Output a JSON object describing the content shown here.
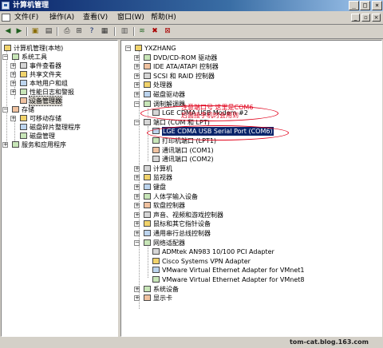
{
  "window": {
    "title": "计算机管理"
  },
  "menu": [
    "文件(F)",
    "操作(A)",
    "查看(V)",
    "窗口(W)",
    "帮助(H)"
  ],
  "toolbar": [
    "back-icon",
    "forward-icon",
    "up-icon",
    "properties-icon",
    "refresh-icon",
    "print-icon",
    "help-icon",
    "console-icon",
    "scan-icon",
    "disable-icon",
    "uninstall-icon"
  ],
  "left_tree": [
    {
      "label": "计算机管理(本地)",
      "depth": 0,
      "expander": "minus"
    },
    {
      "label": "系统工具",
      "depth": 1,
      "expander": "minus"
    },
    {
      "label": "事件查看器",
      "depth": 2,
      "expander": "plus"
    },
    {
      "label": "共享文件夹",
      "depth": 2,
      "expander": "plus"
    },
    {
      "label": "本地用户和组",
      "depth": 2,
      "expander": "plus"
    },
    {
      "label": "性能日志和警报",
      "depth": 2,
      "expander": "plus"
    },
    {
      "label": "设备管理器",
      "depth": 2,
      "expander": "none",
      "selected": true
    },
    {
      "label": "存储",
      "depth": 1,
      "expander": "minus"
    },
    {
      "label": "可移动存储",
      "depth": 2,
      "expander": "plus"
    },
    {
      "label": "磁盘碎片整理程序",
      "depth": 2,
      "expander": "none"
    },
    {
      "label": "磁盘管理",
      "depth": 2,
      "expander": "none"
    },
    {
      "label": "服务和应用程序",
      "depth": 1,
      "expander": "plus"
    }
  ],
  "device_tree": [
    {
      "label": "YXZHANG",
      "depth": 0,
      "expander": "minus"
    },
    {
      "label": "DVD/CD-ROM 驱动器",
      "depth": 1,
      "expander": "plus"
    },
    {
      "label": "IDE ATA/ATAPI 控制器",
      "depth": 1,
      "expander": "plus"
    },
    {
      "label": "SCSI 和 RAID 控制器",
      "depth": 1,
      "expander": "plus"
    },
    {
      "label": "处理器",
      "depth": 1,
      "expander": "plus"
    },
    {
      "label": "磁盘驱动器",
      "depth": 1,
      "expander": "plus"
    },
    {
      "label": "调制解调器",
      "depth": 1,
      "expander": "minus"
    },
    {
      "label": "LGE CDMA USB Modem #2",
      "depth": 2,
      "expander": "none"
    },
    {
      "label": "端口 (COM 和 LPT)",
      "depth": 1,
      "expander": "minus"
    },
    {
      "label": "LGE CDMA USB Serial Port (COM6)",
      "depth": 2,
      "expander": "none",
      "highlight": true
    },
    {
      "label": "打印机端口 (LPT1)",
      "depth": 2,
      "expander": "none"
    },
    {
      "label": "通讯端口 (COM1)",
      "depth": 2,
      "expander": "none"
    },
    {
      "label": "通讯端口 (COM2)",
      "depth": 2,
      "expander": "none"
    },
    {
      "label": "计算机",
      "depth": 1,
      "expander": "plus"
    },
    {
      "label": "监视器",
      "depth": 1,
      "expander": "plus"
    },
    {
      "label": "键盘",
      "depth": 1,
      "expander": "plus"
    },
    {
      "label": "人体学输入设备",
      "depth": 1,
      "expander": "plus"
    },
    {
      "label": "软盘控制器",
      "depth": 1,
      "expander": "plus"
    },
    {
      "label": "声音、视频和游戏控制器",
      "depth": 1,
      "expander": "plus"
    },
    {
      "label": "鼠标和其它指针设备",
      "depth": 1,
      "expander": "plus"
    },
    {
      "label": "通用串行总线控制器",
      "depth": 1,
      "expander": "plus"
    },
    {
      "label": "网络适配器",
      "depth": 1,
      "expander": "minus"
    },
    {
      "label": "ADMtek AN983 10/100 PCI Adapter",
      "depth": 2,
      "expander": "none"
    },
    {
      "label": "Cisco Systems VPN Adapter",
      "depth": 2,
      "expander": "none"
    },
    {
      "label": "VMware Virtual Ethernet Adapter for VMnet1",
      "depth": 2,
      "expander": "none"
    },
    {
      "label": "VMware Virtual Ethernet Adapter for VMnet8",
      "depth": 2,
      "expander": "none"
    },
    {
      "label": "系统设备",
      "depth": 1,
      "expander": "plus"
    },
    {
      "label": "显示卡",
      "depth": 1,
      "expander": "plus"
    }
  ],
  "annotation": {
    "line1": "注意端口号  这里是COM6",
    "line2": "后面接手机时会用到"
  },
  "watermark": "tom-cat.blog.163.com",
  "colors": {
    "annotation": "#e0001a",
    "selection": "#0a246a"
  }
}
